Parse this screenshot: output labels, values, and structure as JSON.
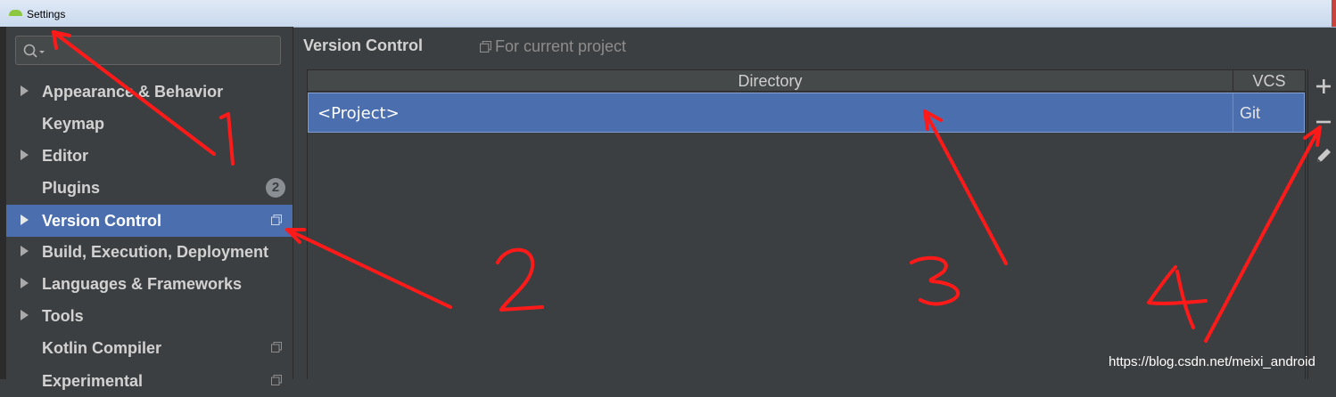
{
  "window": {
    "title": "Settings"
  },
  "search": {
    "placeholder": ""
  },
  "sidebar": {
    "items": [
      {
        "label": "Appearance & Behavior"
      },
      {
        "label": "Keymap"
      },
      {
        "label": "Editor"
      },
      {
        "label": "Plugins",
        "badge": "2"
      },
      {
        "label": "Version Control"
      },
      {
        "label": "Build, Execution, Deployment"
      },
      {
        "label": "Languages & Frameworks"
      },
      {
        "label": "Tools"
      },
      {
        "label": "Kotlin Compiler"
      },
      {
        "label": "Experimental"
      }
    ]
  },
  "content": {
    "title": "Version Control",
    "scope_label": "For current project",
    "table": {
      "headers": [
        "Directory",
        "VCS"
      ],
      "rows": [
        {
          "directory": "<Project>",
          "vcs": "Git"
        }
      ]
    }
  },
  "toolbar": {
    "icons": [
      "add-icon",
      "remove-icon",
      "edit-icon"
    ]
  },
  "annotations": [
    "1",
    "2",
    "3",
    "4"
  ],
  "watermark": "https://blog.csdn.net/meixi_android",
  "colors": {
    "selection": "#4b6eaf",
    "background": "#3c3f41",
    "annotation": "#ff1a1a"
  }
}
